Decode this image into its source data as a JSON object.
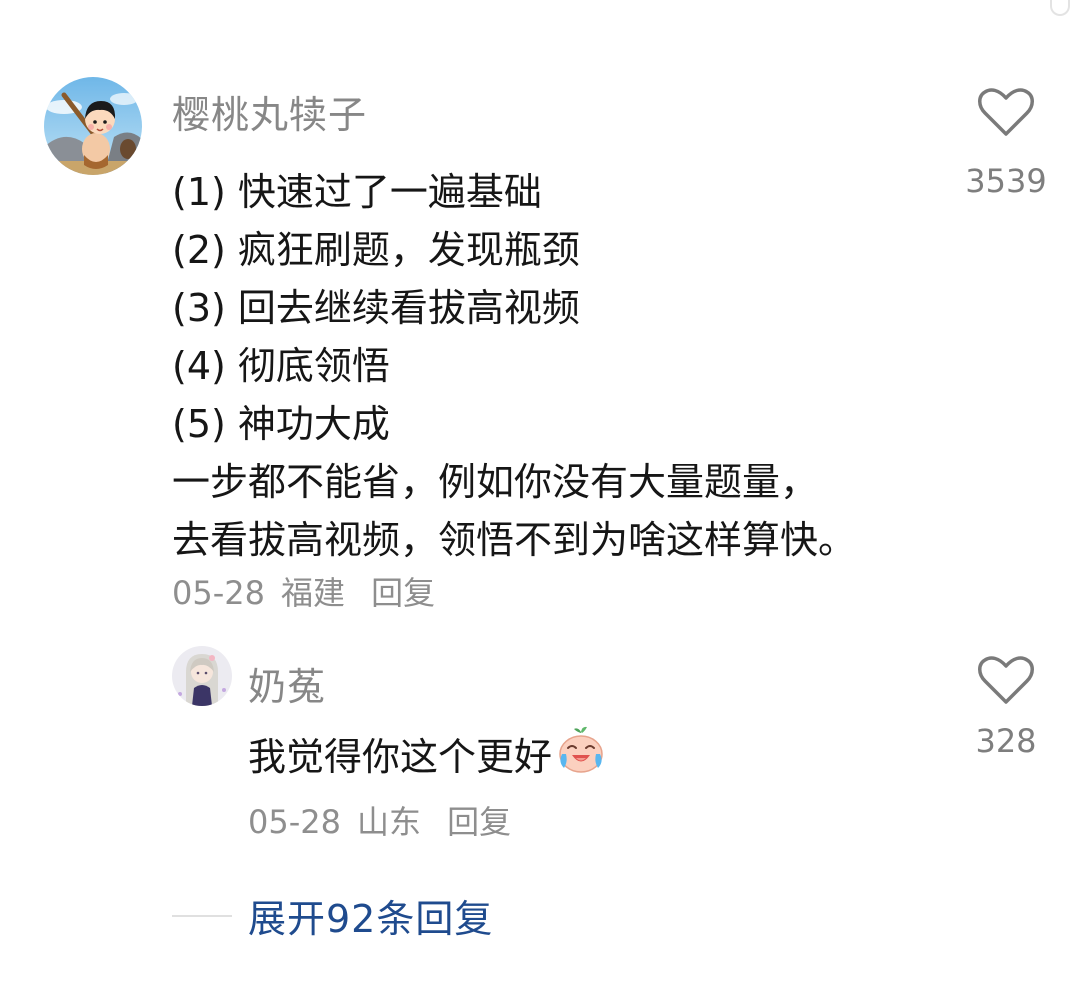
{
  "comment": {
    "username": "樱桃丸犊子",
    "lines": [
      "(1) 快速过了一遍基础",
      "(2) 疯狂刷题，发现瓶颈",
      "(3) 回去继续看拔高视频",
      "(4) 彻底领悟",
      "(5) 神功大成",
      "一步都不能省，例如你没有大量题量，",
      "去看拔高视频，领悟不到为啥这样算快。"
    ],
    "date": "05-28",
    "location": "福建",
    "reply_label": "回复",
    "like_count": "3539",
    "like_icon": "heart-outline-icon"
  },
  "reply": {
    "username": "奶菟",
    "text": "我觉得你这个更好",
    "emoji": "crying-laughing-emoji",
    "date": "05-28",
    "location": "山东",
    "reply_label": "回复",
    "like_count": "328",
    "like_icon": "heart-outline-icon"
  },
  "expand_replies": {
    "label": "展开92条回复"
  },
  "colors": {
    "username": "#878787",
    "text": "#161616",
    "meta": "#8e8e8e",
    "link": "#1f4b8e"
  }
}
